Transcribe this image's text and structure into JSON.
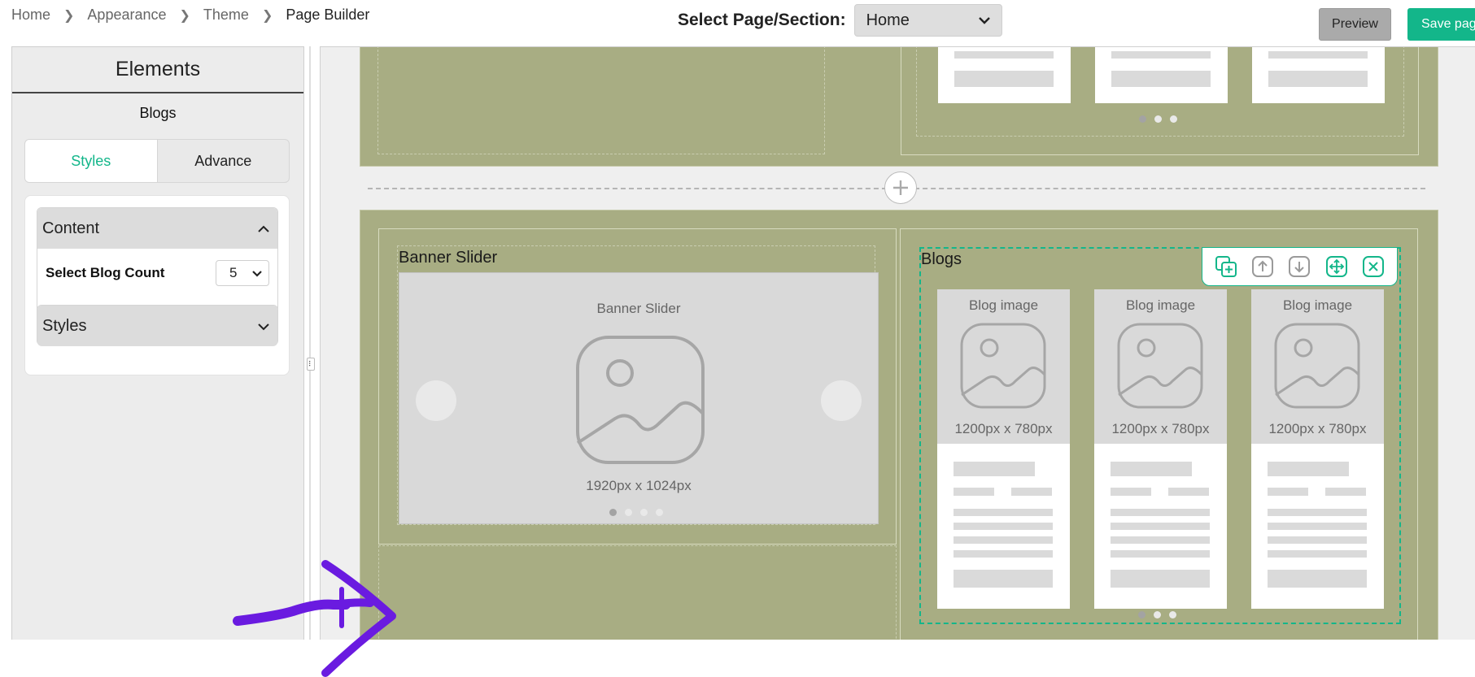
{
  "breadcrumb": [
    "Home",
    "Appearance",
    "Theme",
    "Page Builder"
  ],
  "page_select": {
    "label": "Select Page/Section:",
    "value": "Home"
  },
  "actions": {
    "preview": "Preview",
    "save": "Save page"
  },
  "panel": {
    "title": "Elements",
    "subtitle": "Blogs",
    "tabs": [
      "Styles",
      "Advance"
    ],
    "content_section": {
      "title": "Content",
      "field_label": "Select Blog Count",
      "field_value": "5"
    },
    "styles_section": {
      "title": "Styles"
    }
  },
  "canvas": {
    "banner": {
      "title": "Banner Slider",
      "placeholder": "Banner Slider",
      "size": "1920px x 1024px",
      "slide_count": 4
    },
    "blogs": {
      "title": "Blogs",
      "cards": [
        {
          "image_label": "Blog image",
          "size": "1200px x 780px"
        },
        {
          "image_label": "Blog image",
          "size": "1200px x 780px"
        },
        {
          "image_label": "Blog image",
          "size": "1200px x 780px"
        }
      ],
      "slide_count": 3
    },
    "toolbar_icons": [
      "duplicate-icon",
      "move-up-icon",
      "move-down-icon",
      "drag-move-icon",
      "remove-icon"
    ]
  },
  "colors": {
    "accent": "#13b68a",
    "row_bg": "#a8ad83",
    "annotation": "#6a1be0"
  }
}
